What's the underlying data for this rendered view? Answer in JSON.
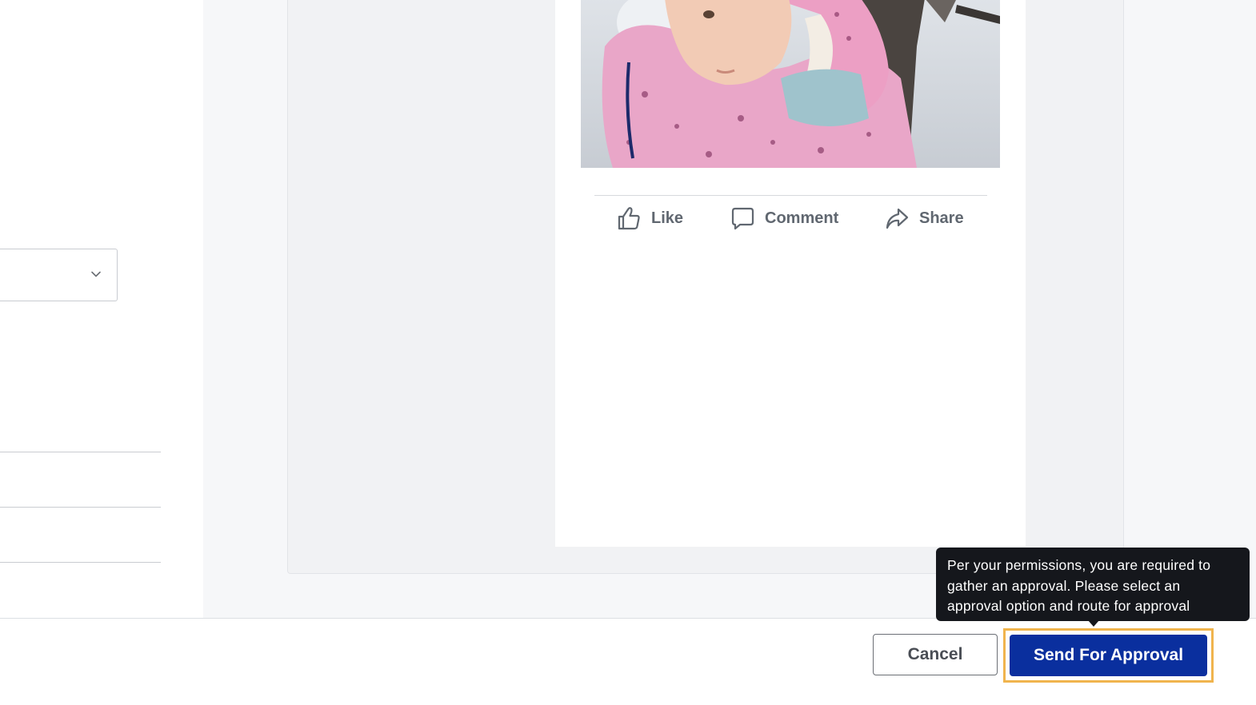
{
  "post_preview": {
    "image_alt": "Child in pink snow jacket and hat in the snow",
    "actions": [
      {
        "label": "Like",
        "icon": "thumbs-up-icon"
      },
      {
        "label": "Comment",
        "icon": "comment-icon"
      },
      {
        "label": "Share",
        "icon": "share-icon"
      }
    ]
  },
  "footer": {
    "cancel_label": "Cancel",
    "submit_label": "Send For Approval"
  },
  "tooltip": {
    "text": "Per your permissions, you are required to gather an approval. Please select an approval option and route for approval"
  },
  "colors": {
    "primary_button": "#0a2f9e",
    "highlight_outline": "#f0b44d",
    "tooltip_bg": "#15171c",
    "action_text": "#606770"
  }
}
